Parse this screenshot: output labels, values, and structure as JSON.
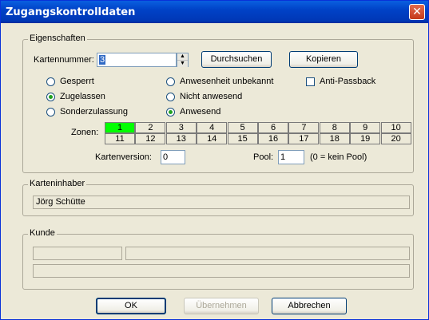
{
  "window": {
    "title": "Zugangskontrolldaten",
    "close_glyph": "✕"
  },
  "eigenschaften": {
    "legend": "Eigenschaften",
    "kartennummer_label": "Kartennummer:",
    "kartennummer_value": "3",
    "durchsuchen": "Durchsuchen",
    "kopieren": "Kopieren",
    "radios": [
      {
        "label": "Gesperrt",
        "checked": false
      },
      {
        "label": "Zugelassen",
        "checked": true
      },
      {
        "label": "Sonderzulassung",
        "checked": false
      },
      {
        "label": "Anwesenheit unbekannt",
        "checked": false
      },
      {
        "label": "Nicht anwesend",
        "checked": false
      },
      {
        "label": "Anwesend",
        "checked": true
      }
    ],
    "anti_passback": "Anti-Passback",
    "zonen_label": "Zonen:",
    "zones_row1": [
      "1",
      "2",
      "3",
      "4",
      "5",
      "6",
      "7",
      "8",
      "9",
      "10"
    ],
    "zones_row2": [
      "11",
      "12",
      "13",
      "14",
      "15",
      "16",
      "17",
      "18",
      "19",
      "20"
    ],
    "kartenversion_label": "Kartenversion:",
    "kartenversion_value": "0",
    "pool_label": "Pool:",
    "pool_value": "1",
    "pool_hint": "(0 = kein Pool)"
  },
  "karteninhaber": {
    "legend": "Karteninhaber",
    "name": "Jörg Schütte"
  },
  "kunde": {
    "legend": "Kunde"
  },
  "buttons": {
    "ok": "OK",
    "uebernehmen": "Übernehmen",
    "abbrechen": "Abbrechen"
  },
  "colors": {
    "active_zone": "#00ff00",
    "titlebar": "#0042c7"
  }
}
